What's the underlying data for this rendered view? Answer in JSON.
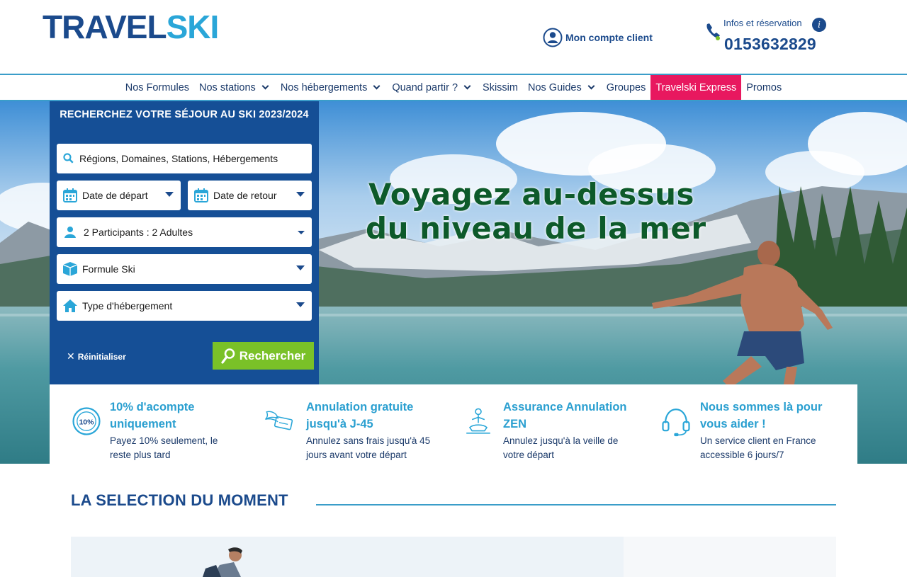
{
  "header": {
    "logo_travel": "TRAVEL",
    "logo_ski": "SKI",
    "account_label": "Mon compte client",
    "info_label": "Infos et réservation",
    "info_icon": "i",
    "phone": "0153632829"
  },
  "nav": {
    "items": [
      {
        "label": "Nos Formules",
        "chevron": false
      },
      {
        "label": "Nos stations",
        "chevron": true
      },
      {
        "label": "Nos hébergements",
        "chevron": true
      },
      {
        "label": "Quand partir ?",
        "chevron": true
      },
      {
        "label": "Skissim",
        "chevron": false
      },
      {
        "label": "Nos Guides",
        "chevron": true
      },
      {
        "label": "Groupes",
        "chevron": false
      },
      {
        "label": "Travelski Express",
        "chevron": false
      },
      {
        "label": "Promos",
        "chevron": false
      }
    ]
  },
  "hero": {
    "line1": "Voyagez au-dessus",
    "line2": "du niveau de la mer"
  },
  "search": {
    "title": "RECHERCHEZ VOTRE SÉJOUR AU SKI 2023/2024",
    "destination": "Régions, Domaines, Stations, Hébergements",
    "date_depart": "Date de départ",
    "date_retour": "Date de retour",
    "participants": "2 Participants : 2 Adultes",
    "formule": "Formule Ski",
    "hebergement": "Type d'hébergement",
    "reset_label": "Réinitialiser",
    "search_label": "Rechercher"
  },
  "features": [
    {
      "icon": "ten-percent-icon",
      "badge": "10%",
      "title": "10% d'acompte uniquement",
      "desc": "Payez 10% seulement, le reste plus tard"
    },
    {
      "icon": "winged-ticket-icon",
      "title": "Annulation gratuite jusqu'à J-45",
      "desc": "Annulez sans frais jusqu'à 45 jours avant votre départ"
    },
    {
      "icon": "meditation-icon",
      "title": "Assurance Annulation ZEN",
      "desc": "Annulez jusqu'à la veille de votre départ"
    },
    {
      "icon": "headset-icon",
      "title": "Nous sommes là pour vous aider !",
      "desc": "Un service client en France accessible 6 jours/7"
    }
  ],
  "selection": {
    "title": "LA SELECTION DU MOMENT"
  },
  "colors": {
    "brand_dark": "#1b4a8c",
    "brand_light": "#2aa6d8",
    "express": "#e8185f",
    "search_bg": "#154f96",
    "search_btn": "#7ac128"
  }
}
